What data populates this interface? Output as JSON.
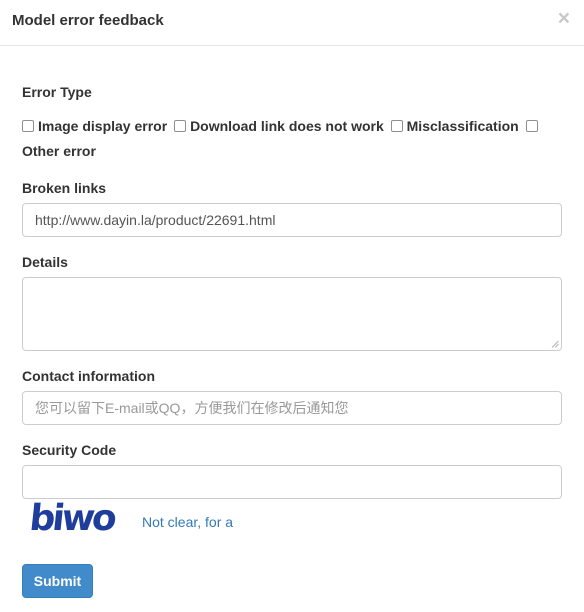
{
  "modal": {
    "title": "Model error feedback",
    "close_glyph": "×"
  },
  "error_type": {
    "label": "Error Type",
    "options": [
      {
        "label": "Image display error",
        "checked": false
      },
      {
        "label": "Download link does not work",
        "checked": false
      },
      {
        "label": "Misclassification",
        "checked": false
      },
      {
        "label": "Other error",
        "checked": false
      }
    ]
  },
  "broken_links": {
    "label": "Broken links",
    "value": "http://www.dayin.la/product/22691.html"
  },
  "details": {
    "label": "Details",
    "value": ""
  },
  "contact": {
    "label": "Contact information",
    "placeholder": "您可以留下E-mail或QQ，方便我们在修改后通知您"
  },
  "security": {
    "label": "Security Code",
    "value": "",
    "captcha_text": "biwo",
    "refresh_link": "Not clear, for a"
  },
  "submit": {
    "label": "Submit"
  },
  "colors": {
    "primary": "#428bca",
    "link": "#337ab7",
    "captcha": "#1f3d9c"
  }
}
